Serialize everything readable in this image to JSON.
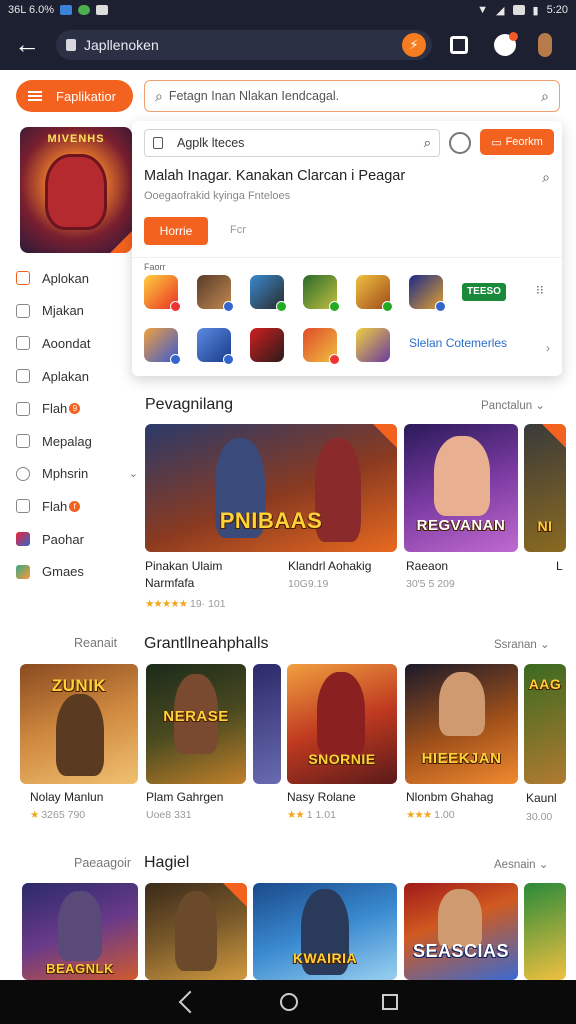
{
  "statusbar": {
    "left_text": "36L 6.0%",
    "time": "5:20"
  },
  "appbar": {
    "url": "Japllenoken"
  },
  "topbar": {
    "menu_label": "Faplikatior",
    "search_placeholder": "Fetagn Inan Nlakan Iendcagal."
  },
  "promo_card": {
    "title": "MIVENHS"
  },
  "sidebar": {
    "items": [
      {
        "label": "Aplokan",
        "icon": "app-icon"
      },
      {
        "label": "Mjakan",
        "icon": "grid-icon"
      },
      {
        "label": "Aoondat",
        "icon": "lock-icon",
        "chevron": "›"
      },
      {
        "label": "Aplakan",
        "icon": "home-icon"
      },
      {
        "label": "Flah",
        "icon": "tag-icon",
        "badge": "9"
      },
      {
        "label": "Mepalag",
        "icon": "list-icon"
      },
      {
        "label": "Mphsrin",
        "icon": "user-icon",
        "chevron": "⌄"
      },
      {
        "label": "Flah",
        "icon": "doc-icon",
        "badge": "f"
      },
      {
        "label": "Paohar",
        "icon": "game-icon"
      },
      {
        "label": "Gmaes",
        "icon": "controller-icon"
      }
    ]
  },
  "popup": {
    "input_value": "Agplk lteces",
    "button_label": "Feorkm",
    "headline": "Malah Inagar. Kanakan  Clarcan i Peagar",
    "sub": "Ooegaofrakid kyinga Fnteloes",
    "home_button": "Horrie",
    "alt_link": "Fcr",
    "row_label": "Faorr",
    "tag": "TEESO",
    "link": "Slelan Cotemerles"
  },
  "section1": {
    "title": "Pevagnilang",
    "more": "Panctalun",
    "tiles": [
      {
        "title": "PNIBAAS"
      },
      {
        "title": "REGVANAN"
      },
      {
        "title": "NI"
      }
    ],
    "captions": [
      {
        "name": "Pinakan Ulaim Narmfafa",
        "meta": "",
        "rating": "★★★★★",
        "rating_text": "19· 101"
      },
      {
        "name": "Klandrl Aohakig",
        "meta": "10G9.19"
      },
      {
        "name": "Raeaon",
        "meta": "30'5 5 209"
      },
      {
        "name": "L",
        "meta": ""
      }
    ]
  },
  "section2": {
    "left": "Reanait",
    "title": "Grantllneahphalls",
    "more": "Ssranan",
    "tiles": [
      {
        "title": "ZUNIK"
      },
      {
        "title": "NERASE"
      },
      {
        "title": ""
      },
      {
        "title": "SNORNIE"
      },
      {
        "title": "HIEEKJAN"
      },
      {
        "title": "AAG"
      }
    ],
    "captions": [
      {
        "name": "Nolay Manlun",
        "meta": "3265 790",
        "rating": "★"
      },
      {
        "name": "Plam Gahrgen",
        "meta": "Uoe8 331"
      },
      {
        "name": "Nasy Rolane",
        "meta": "1 1.01",
        "rating": "★★"
      },
      {
        "name": "Nlonbm Ghahag",
        "meta": "1.00",
        "rating": "★★★"
      },
      {
        "name": "Kaunl",
        "meta": "30.00"
      }
    ]
  },
  "section3": {
    "left": "Paeaagoir",
    "title": "Hagiel",
    "more": "Aesnain",
    "tiles": [
      {
        "title": "BEAGNLK"
      },
      {
        "title": ""
      },
      {
        "title": "KWAIRIA"
      },
      {
        "title": "SEASCIAS"
      },
      {
        "title": ""
      }
    ]
  }
}
